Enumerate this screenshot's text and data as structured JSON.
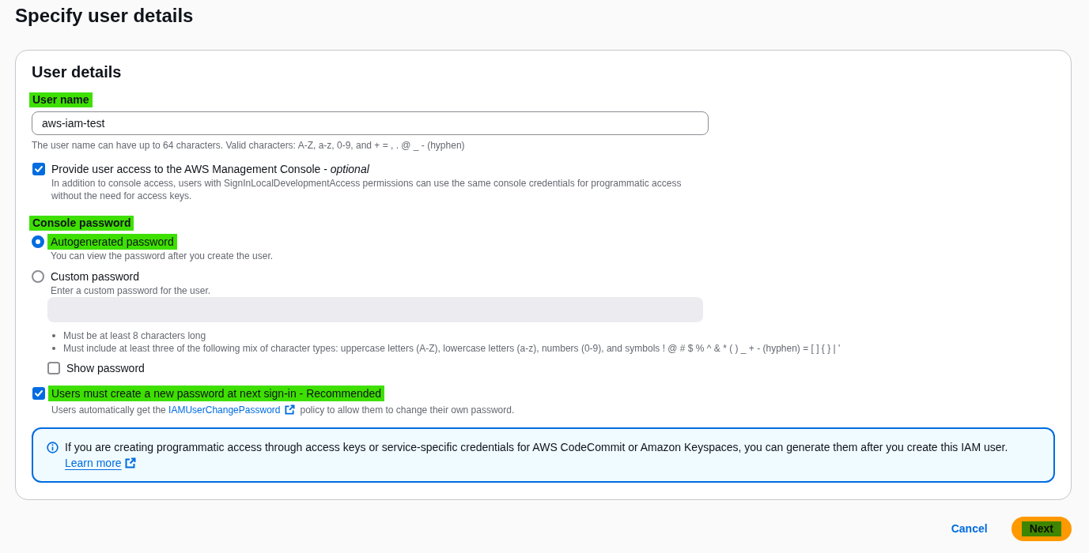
{
  "page": {
    "title": "Specify user details"
  },
  "user_details": {
    "heading": "User details",
    "user_name": {
      "label": "User name",
      "highlighted": true,
      "value": "aws-iam-test",
      "hint": "The user name can have up to 64 characters. Valid characters: A-Z, a-z, 0-9, and + = , . @ _ - (hyphen)"
    },
    "console_access": {
      "label": "Provide user access to the AWS Management Console - *optional*",
      "checked": true,
      "highlighted": false,
      "description": "In addition to console access, users with SignInLocalDevelopmentAccess permissions can use the same console credentials for programmatic access without the need for access keys."
    },
    "console_password": {
      "label": "Console password",
      "highlighted": true,
      "options": [
        {
          "label": "Autogenerated password",
          "selected": true,
          "highlighted": true,
          "description": "You can view the password after you create the user."
        },
        {
          "label": "Custom password",
          "selected": false,
          "highlighted": false,
          "description": "Enter a custom password for the user."
        }
      ],
      "password_field": {
        "disabled": true
      },
      "requirements": [
        "Must be at least 8 characters long",
        "Must include at least three of the following mix of character types: uppercase letters (A-Z), lowercase letters (a-z), numbers (0-9), and symbols ! @ # $ % ^ & * ( ) _ + - (hyphen) = [ ] { } | '"
      ],
      "show_password": {
        "label": "Show password",
        "checked": false
      }
    },
    "require_reset": {
      "label": "Users must create a new password at next sign-in - Recommended",
      "checked": true,
      "highlighted": true,
      "description": {
        "before": "Users automatically get the",
        "link": "IAMUserChangePassword",
        "after": "policy to allow them to change their own password."
      }
    },
    "info_alert": {
      "text": "If you are creating programmatic access through access keys or service-specific credentials for AWS CodeCommit or Amazon Keyspaces, you can generate them after you create this IAM user.",
      "link": "Learn more"
    }
  },
  "actions": [
    {
      "label": "Cancel",
      "kind": "link",
      "highlighted": false
    },
    {
      "label": "Next",
      "kind": "primary",
      "highlighted": true
    }
  ]
}
